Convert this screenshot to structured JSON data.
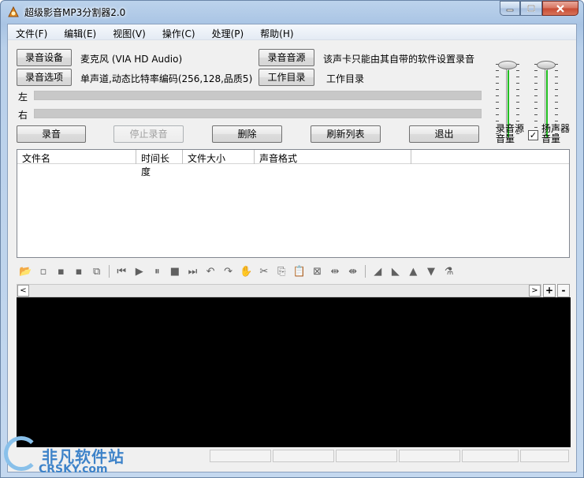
{
  "window": {
    "title": "超级影音MP3分割器2.0"
  },
  "menu": [
    {
      "label": "文件(F)"
    },
    {
      "label": "编辑(E)"
    },
    {
      "label": "视图(V)"
    },
    {
      "label": "操作(C)"
    },
    {
      "label": "处理(P)"
    },
    {
      "label": "帮助(H)"
    }
  ],
  "record": {
    "device_button": "录音设备",
    "device_value": "麦克风 (VIA HD Audio)",
    "options_button": "录音选项",
    "options_value": "单声道,动态比特率编码(256,128,品质5)",
    "source_button": "录音音源",
    "source_note": "该声卡只能由其自带的软件设置录音",
    "workdir_button": "工作目录",
    "workdir_value": "工作目录",
    "left_label": "左",
    "right_label": "右"
  },
  "actions": {
    "record": "录音",
    "stop": "停止录音",
    "delete": "删除",
    "refresh": "刷新列表",
    "exit": "退出"
  },
  "volume": {
    "source_label_1": "录音源",
    "source_label_2": "音量",
    "speaker_label_1": "扬声器",
    "speaker_label_2": "音量",
    "speaker_checked": true,
    "source_level": 0.95,
    "speaker_level": 0.95
  },
  "filelist": {
    "columns": [
      "文件名",
      "时间长度",
      "文件大小",
      "声音格式"
    ],
    "rows": []
  },
  "toolbar_icons": [
    "open-folder-icon",
    "close-file-icon",
    "save-icon",
    "save-as-icon",
    "export-icon",
    "skip-start-icon",
    "play-icon",
    "pause-icon",
    "stop-icon",
    "skip-end-icon",
    "undo-icon",
    "redo-icon",
    "hand-icon",
    "cut-icon",
    "copy-icon",
    "paste-icon",
    "delete-selection-icon",
    "trim-icon",
    "split-icon",
    "fade-in-icon",
    "fade-out-icon",
    "volume-up-icon",
    "volume-down-icon",
    "effects-icon"
  ],
  "scroll": {
    "left_arrow": "<",
    "right_arrow": ">",
    "zoom_in": "+",
    "zoom_out": "-"
  },
  "watermark": {
    "text": "非凡软件站",
    "sub": "CRSKY.com"
  },
  "colors": {
    "level_fill": "#20c020",
    "wave_background": "#000000",
    "watermark": "#3e83c9"
  }
}
